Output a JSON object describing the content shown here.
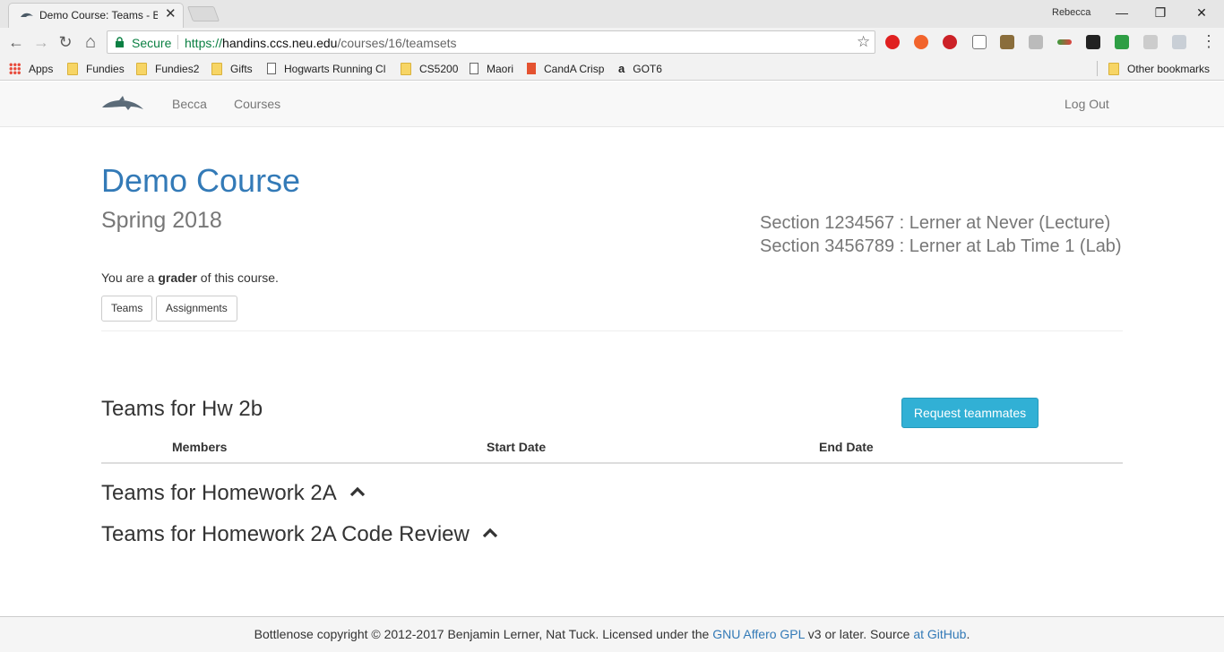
{
  "browser": {
    "tab_title": "Demo Course: Teams - Bottlenose",
    "tab_close": "✕",
    "profile_name": "Rebecca",
    "window": {
      "minimize": "—",
      "restore": "❐",
      "close": "✕"
    },
    "nav": {
      "back": "←",
      "forward": "→",
      "reload": "↻",
      "home": "⌂",
      "star": "☆",
      "menu": "⋮"
    },
    "secure_label": "Secure",
    "url_scheme": "https://",
    "url_host": "handins.ccs.neu.edu",
    "url_path": "/courses/16/teamsets"
  },
  "bookmarks": {
    "apps": "Apps",
    "items": [
      "Fundies",
      "Fundies2",
      "Gifts",
      "Hogwarts Running Cl",
      "CS5200",
      "Maori",
      "CandA Crisp",
      "GOT6"
    ],
    "other": "Other bookmarks"
  },
  "site_nav": {
    "user": "Becca",
    "courses": "Courses",
    "logout": "Log Out"
  },
  "course": {
    "title": "Demo Course",
    "term": "Spring 2018",
    "sections": [
      "Section 1234567 : Lerner at Never (Lecture)",
      "Section 3456789 : Lerner at Lab Time 1 (Lab)"
    ],
    "role_prefix": "You are a ",
    "role": "grader",
    "role_suffix": " of this course."
  },
  "buttons": {
    "teams": "Teams",
    "assignments": "Assignments",
    "request_teammates": "Request teammates"
  },
  "teamsets": [
    {
      "title": "Teams for Hw 2b"
    },
    {
      "title": "Teams for Homework 2A"
    },
    {
      "title": "Teams for Homework 2A Code Review"
    }
  ],
  "table": {
    "headers": [
      "Members",
      "Start Date",
      "End Date"
    ]
  },
  "footer": {
    "prefix": "Bottlenose copyright © 2012-2017 Benjamin Lerner, Nat Tuck. Licensed under the ",
    "license_link": "GNU Affero GPL",
    "middle": " v3 or later. Source ",
    "source_link": "at GitHub",
    "suffix": "."
  },
  "colors": {
    "link": "#337ab7",
    "info_button": "#31b0d5",
    "secure_green": "#0b8043"
  }
}
